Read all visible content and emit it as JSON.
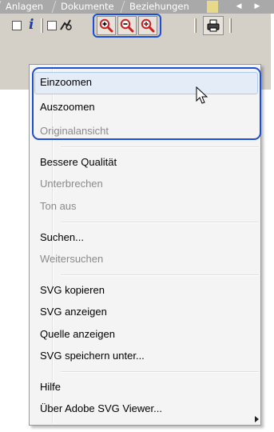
{
  "tabs": [
    {
      "label": "Anlagen"
    },
    {
      "label": "Dokumente"
    },
    {
      "label": "Beziehungen"
    }
  ],
  "tab_nav": {
    "prev": "◀",
    "next": "▶"
  },
  "toolbar": {
    "info_glyph": "i",
    "zoom_in_icon": "zoom-in-icon",
    "zoom_out_icon": "zoom-out-icon",
    "zoom_original_icon": "zoom-original-icon",
    "print_icon": "print-icon"
  },
  "context_menu": {
    "groups": [
      [
        {
          "label": "Einzoomen",
          "enabled": true,
          "highlighted": true
        },
        {
          "label": "Auszoomen",
          "enabled": true
        },
        {
          "label": "Originalansicht",
          "enabled": false
        }
      ],
      [
        {
          "label": "Bessere Qualität",
          "enabled": true
        },
        {
          "label": "Unterbrechen",
          "enabled": false
        },
        {
          "label": "Ton aus",
          "enabled": false
        }
      ],
      [
        {
          "label": "Suchen...",
          "enabled": true
        },
        {
          "label": "Weitersuchen",
          "enabled": false
        }
      ],
      [
        {
          "label": "SVG kopieren",
          "enabled": true
        },
        {
          "label": "SVG anzeigen",
          "enabled": true
        },
        {
          "label": "Quelle anzeigen",
          "enabled": true
        },
        {
          "label": "SVG speichern unter...",
          "enabled": true
        }
      ],
      [
        {
          "label": "Hilfe",
          "enabled": true
        },
        {
          "label": "Über Adobe SVG Viewer...",
          "enabled": true
        }
      ]
    ]
  },
  "colors": {
    "annotation_outline": "#1c4fd8",
    "zoom_icon_red": "#cc1f1f",
    "highlight_bg": "#e3ecf7",
    "tab_strip": "#a9a9a9"
  }
}
